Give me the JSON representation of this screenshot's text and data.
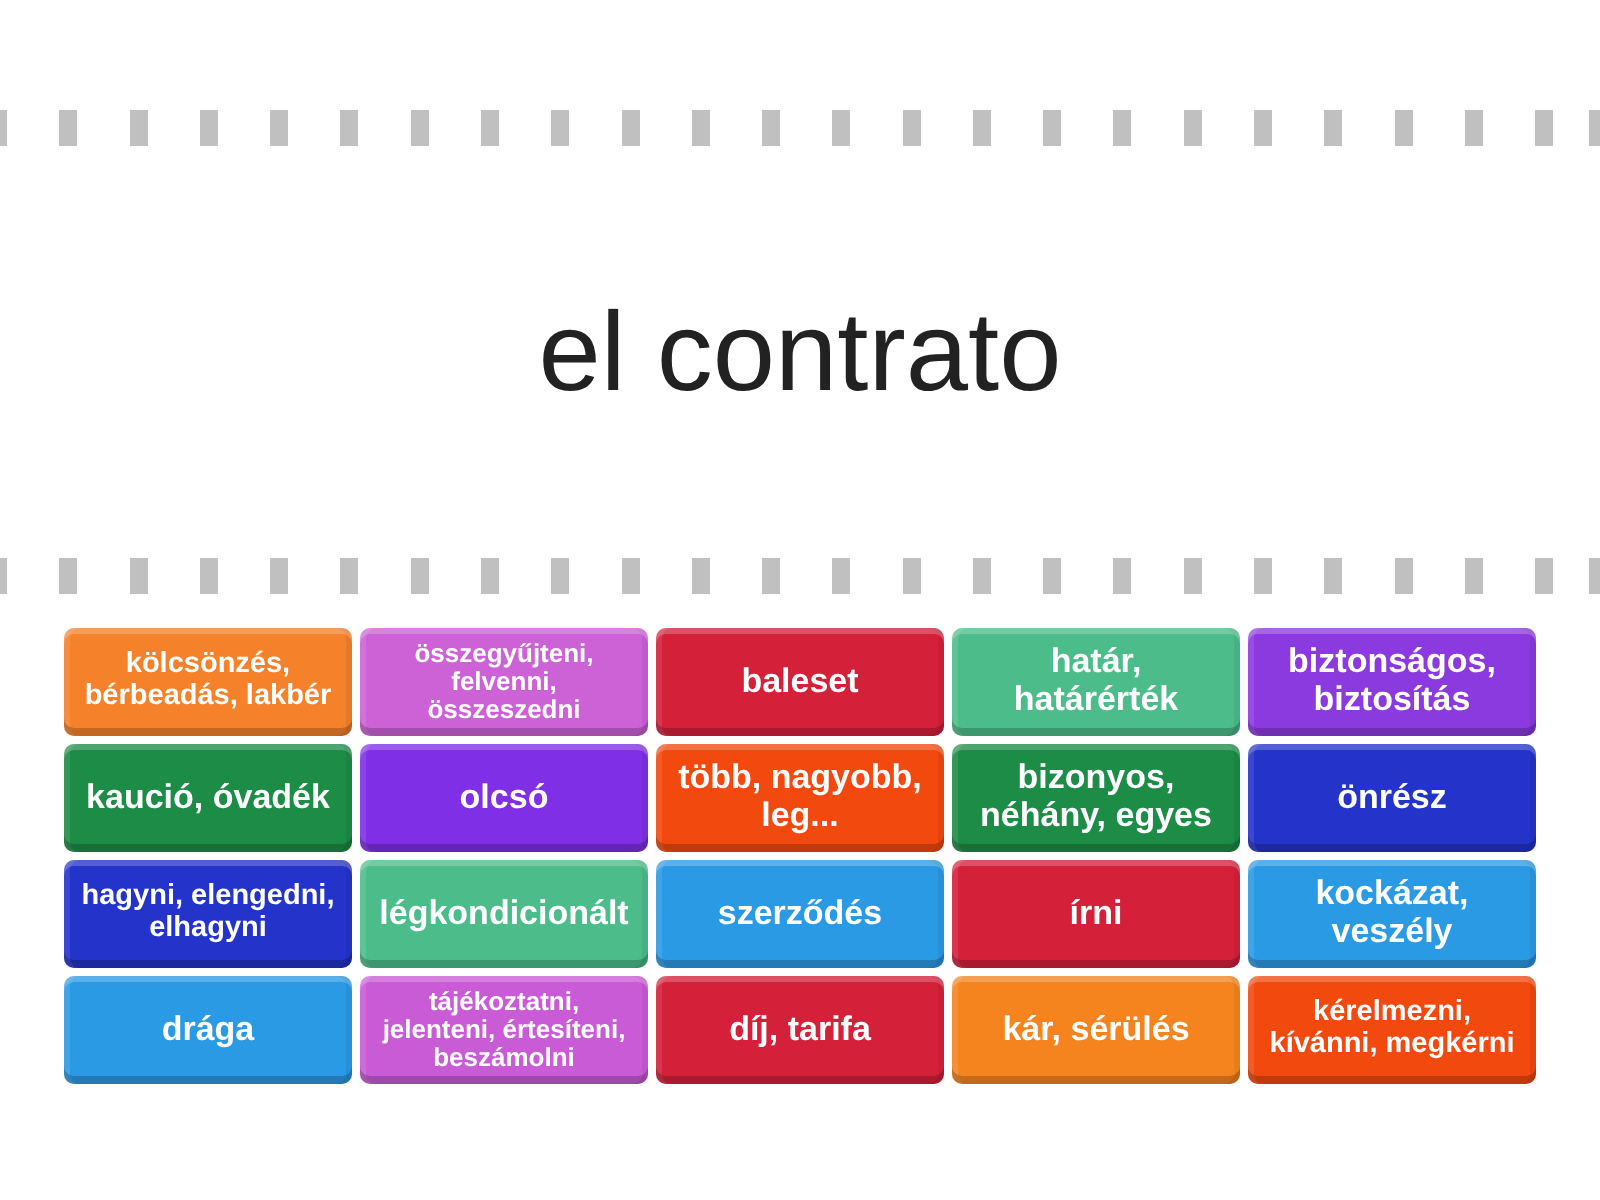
{
  "prompt": "el contrato",
  "answers": [
    {
      "text": "kölcsönzés, bérbeadás, lakbér",
      "color": "#f5812a"
    },
    {
      "text": "összegyűjteni, felvenni, összeszedni",
      "color": "#cc62d6"
    },
    {
      "text": "baleset",
      "color": "#d5203a"
    },
    {
      "text": "határ, határérték",
      "color": "#4cbd8a"
    },
    {
      "text": "biztonságos, biztosítás",
      "color": "#8b3ae0"
    },
    {
      "text": "kaució, óvadék",
      "color": "#1d8c47"
    },
    {
      "text": "olcsó",
      "color": "#7f2fe6"
    },
    {
      "text": "több, nagyobb, leg...",
      "color": "#f2490f"
    },
    {
      "text": "bizonyos, néhány, egyes",
      "color": "#1d8c47"
    },
    {
      "text": "önrész",
      "color": "#2433c9"
    },
    {
      "text": "hagyni, elengedni, elhagyni",
      "color": "#2433c9"
    },
    {
      "text": "légkondicionált",
      "color": "#4cbd8a"
    },
    {
      "text": "szerződés",
      "color": "#2b9ae4"
    },
    {
      "text": "írni",
      "color": "#d5203a"
    },
    {
      "text": "kockázat, veszély",
      "color": "#2b9ae4"
    },
    {
      "text": "drága",
      "color": "#2b9ae4"
    },
    {
      "text": "tájékoztatni, jelenteni, értesíteni, beszámolni",
      "color": "#c95bd6"
    },
    {
      "text": "díj, tarifa",
      "color": "#d5203a"
    },
    {
      "text": "kár, sérülés",
      "color": "#f5841f"
    },
    {
      "text": "kérelmezni, kívánni, megkérni",
      "color": "#f2490f"
    }
  ]
}
